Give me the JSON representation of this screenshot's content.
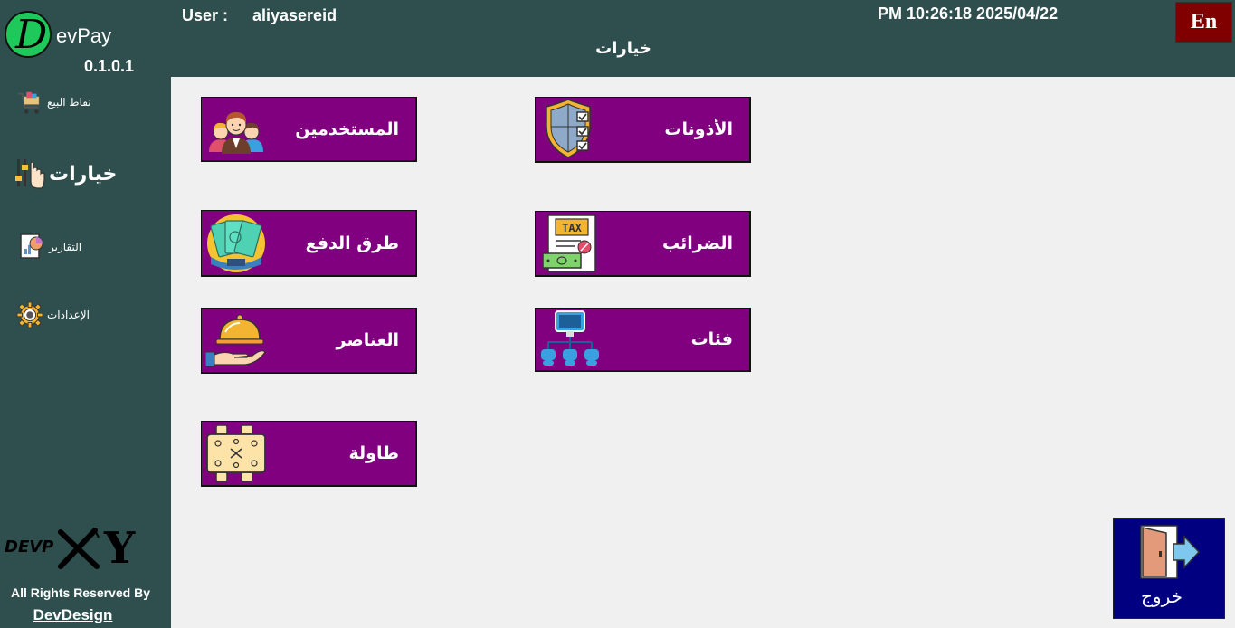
{
  "app": {
    "logo_letter": "D",
    "logo_text": "evPay",
    "version": "0.1.0.1"
  },
  "header": {
    "user_label": "User :",
    "user_name": "aliyasereid",
    "datetime": "PM 10:26:18 2025/04/22",
    "page_title": "خيارات",
    "lang_button": "En"
  },
  "sidebar": {
    "items": [
      {
        "label": "نقاط البيع",
        "icon": "shopping-cart-icon"
      },
      {
        "label": "خيارات",
        "icon": "hand-sliders-icon"
      },
      {
        "label": "التقارير",
        "icon": "report-icon"
      },
      {
        "label": "الإعدادات",
        "icon": "gear-icon"
      }
    ],
    "brand_logo_text": "DEVP",
    "brand_logo_y": "Y",
    "rights": "All Rights Reserved By",
    "company": "DevDesign"
  },
  "tiles": [
    {
      "label": "المستخدمين",
      "icon": "users-icon"
    },
    {
      "label": "الأذونات",
      "icon": "shield-checklist-icon"
    },
    {
      "label": "طرق الدفع",
      "icon": "cash-icon"
    },
    {
      "label": "الضرائب",
      "icon": "tax-icon",
      "icon_text": "TAX"
    },
    {
      "label": "العناصر",
      "icon": "serving-tray-icon"
    },
    {
      "label": "فئات",
      "icon": "hierarchy-icon"
    },
    {
      "label": "طاولة",
      "icon": "table-icon"
    }
  ],
  "exit": {
    "label": "خروج",
    "icon": "exit-door-icon"
  },
  "colors": {
    "sidebar": "#2f4f4f",
    "tile": "#800080",
    "lang_button": "#800000",
    "exit_button": "#000080",
    "logo": "#1ec85a"
  }
}
